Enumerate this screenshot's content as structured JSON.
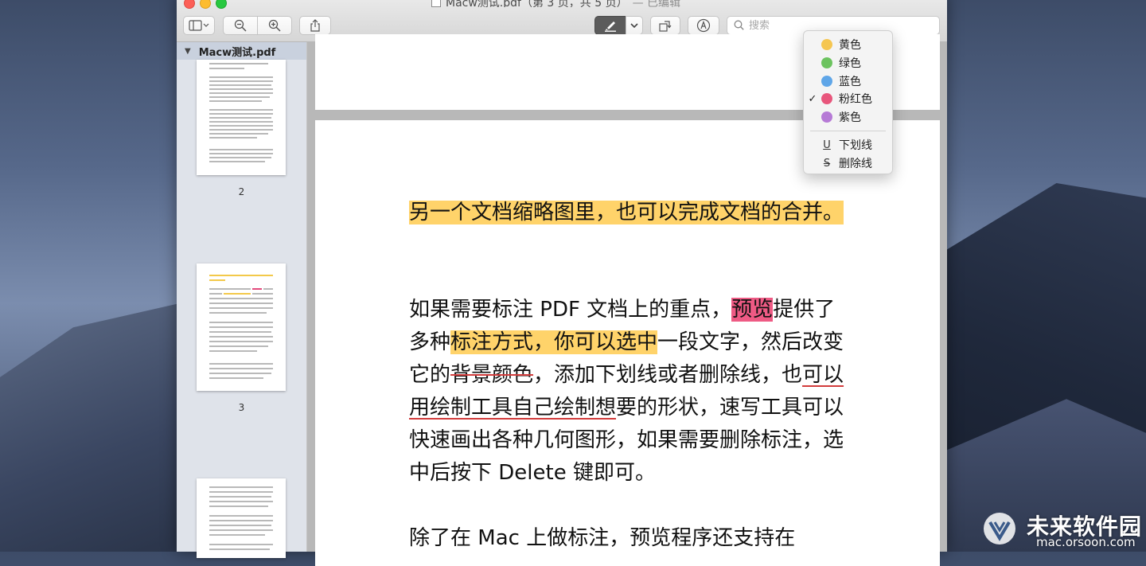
{
  "window": {
    "file_name": "Macw测试.pdf",
    "page_info": "（第 3 页，共 5 页）",
    "edited_label": "— 已编辑"
  },
  "toolbar": {
    "search_placeholder": "搜索",
    "icons": {
      "sidebar": "sidebar-toggle-icon",
      "zoom_out": "zoom-out-icon",
      "zoom_in": "zoom-in-icon",
      "share": "share-icon",
      "highlight": "highlighter-icon",
      "highlight_menu": "chevron-down-icon",
      "rotate": "rotate-icon",
      "markup": "markup-pen-icon",
      "search": "magnifier-icon"
    }
  },
  "sidebar": {
    "header": "Macw测试.pdf",
    "page_numbers": [
      "2",
      "3"
    ]
  },
  "highlight_menu": {
    "colors": [
      {
        "label": "黄色",
        "color": "#f5c651",
        "checked": false
      },
      {
        "label": "绿色",
        "color": "#6cc35f",
        "checked": false
      },
      {
        "label": "蓝色",
        "color": "#5fa6e8",
        "checked": false
      },
      {
        "label": "粉红色",
        "color": "#e8567c",
        "checked": true
      },
      {
        "label": "紫色",
        "color": "#b67ad6",
        "checked": false
      }
    ],
    "styles": [
      {
        "label": "下划线",
        "glyph": "U"
      },
      {
        "label": "删除线",
        "glyph": "S"
      }
    ],
    "check_glyph": "✓"
  },
  "document": {
    "para1": "另一个文档缩略图里，也可以完成文档的合并。",
    "para2": {
      "t1": "如果需要标注 PDF 文档上的重点，",
      "pink": "预览",
      "t2": "提供了多种",
      "yellow": "标注方式，你可以选中",
      "t3": "一段文字，然后改变它的",
      "strike": "背景颜色",
      "t4": "，添加下划线或者删除线，也",
      "underline": "可以用绘制工具自己绘制想",
      "t5": "要的形状，速写工具可以快速画出各种几何图形，如果需要删除标注，选中后按下 Delete 键即可。"
    },
    "para3": "除了在 Mac 上做标注，预览程序还支持在"
  },
  "watermark": {
    "name": "未来软件园",
    "url": "mac.orsoon.com"
  }
}
